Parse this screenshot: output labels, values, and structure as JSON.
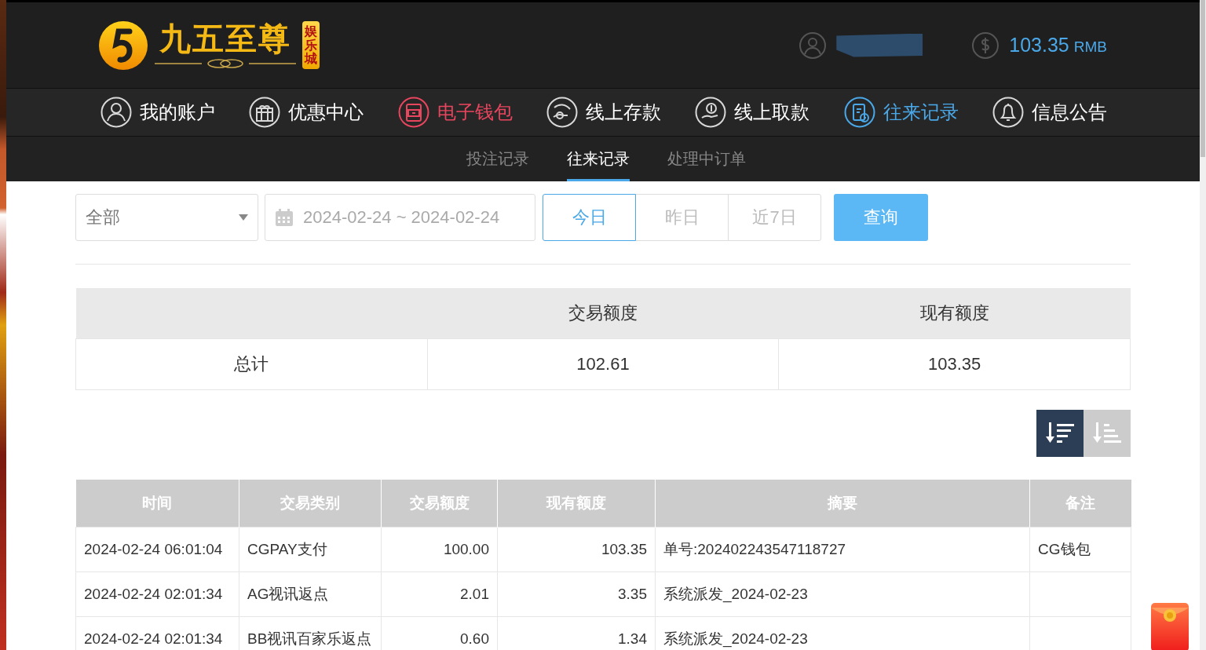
{
  "logo": {
    "name": "九五至尊",
    "badge": "娱乐城"
  },
  "account": {
    "balance": "103.35",
    "currency": "RMB"
  },
  "nav": [
    {
      "label": "我的账户",
      "kind": "user",
      "selected": false,
      "hovered": false
    },
    {
      "label": "优惠中心",
      "kind": "gift",
      "selected": false,
      "hovered": false
    },
    {
      "label": "电子钱包",
      "kind": "wallet",
      "selected": false,
      "hovered": true
    },
    {
      "label": "线上存款",
      "kind": "deposit",
      "selected": false,
      "hovered": false
    },
    {
      "label": "线上取款",
      "kind": "withdraw",
      "selected": false,
      "hovered": false
    },
    {
      "label": "往来记录",
      "kind": "records",
      "selected": true,
      "hovered": false
    },
    {
      "label": "信息公告",
      "kind": "bell",
      "selected": false,
      "hovered": false
    }
  ],
  "subnav": [
    {
      "label": "投注记录",
      "selected": false
    },
    {
      "label": "往来记录",
      "selected": true
    },
    {
      "label": "处理中订单",
      "selected": false
    }
  ],
  "filter": {
    "type": "全部",
    "date_range": "2024-02-24 ~ 2024-02-24",
    "quick_ranges": [
      {
        "label": "今日",
        "selected": true
      },
      {
        "label": "昨日",
        "selected": false
      },
      {
        "label": "近7日",
        "selected": false
      }
    ],
    "query_button": "查询"
  },
  "summary": {
    "columns": [
      "交易额度",
      "现有额度"
    ],
    "row": {
      "label": "总计",
      "values": [
        "102.61",
        "103.35"
      ]
    }
  },
  "sort_buttons": [
    {
      "kind": "descending",
      "selected": true
    },
    {
      "kind": "ascending",
      "selected": false
    }
  ],
  "table": {
    "columns": [
      "时间",
      "交易类别",
      "交易额度",
      "现有额度",
      "摘要",
      "备注"
    ],
    "rows": [
      {
        "time": "2024-02-24 06:01:04",
        "type": "CGPAY支付",
        "amount": "100.00",
        "balance": "103.35",
        "summary": "单号:202402243547118727",
        "note": "CG钱包"
      },
      {
        "time": "2024-02-24 02:01:34",
        "type": "AG视讯返点",
        "amount": "2.01",
        "balance": "3.35",
        "summary": "系统派发_2024-02-23"
      },
      {
        "time": "2024-02-24 02:01:34",
        "type": "BB视讯百家乐返点",
        "amount": "0.60",
        "balance": "1.34",
        "summary": "系统派发_2024-02-23"
      }
    ]
  }
}
